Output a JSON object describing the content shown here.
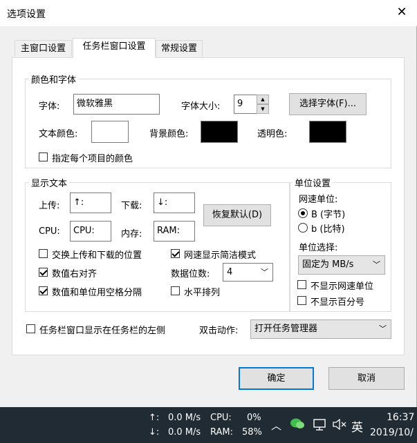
{
  "window": {
    "title": "选项设置",
    "close_glyph": "✕"
  },
  "tabs": [
    {
      "label": "主窗口设置"
    },
    {
      "label": "任务栏窗口设置"
    },
    {
      "label": "常规设置"
    }
  ],
  "color_font": {
    "group_label": "颜色和字体",
    "font_label": "字体:",
    "font_value": "微软雅黑",
    "size_label": "字体大小:",
    "size_value": "9",
    "choose_font_button": "选择字体(F)...",
    "text_color_label": "文本颜色:",
    "text_color": "#ffffff",
    "bg_color_label": "背景颜色:",
    "bg_color": "#000000",
    "transparent_label": "透明色:",
    "transparent_color": "#000000",
    "per_item_color_label": "指定每个项目的颜色",
    "per_item_color_checked": false
  },
  "display_text": {
    "group_label": "显示文本",
    "upload_label": "上传:",
    "upload_value": "↑:",
    "download_label": "下载:",
    "download_value": "↓:",
    "cpu_label": "CPU:",
    "cpu_value": "CPU:",
    "memory_label": "内存:",
    "memory_value": "RAM:",
    "restore_default_button": "恢复默认(D)",
    "swap_label": "交换上传和下载的位置",
    "swap_checked": false,
    "simple_mode_label": "网速显示简洁模式",
    "simple_mode_checked": true,
    "right_align_label": "数值右对齐",
    "right_align_checked": true,
    "digits_label": "数据位数:",
    "digits_value": "4",
    "space_sep_label": "数值和单位用空格分隔",
    "space_sep_checked": true,
    "horizontal_label": "水平排列",
    "horizontal_checked": false
  },
  "unit_settings": {
    "group_label": "单位设置",
    "speed_unit_label": "网速单位:",
    "byte_option": "B (字节)",
    "byte_selected": true,
    "bit_option": "b (比特)",
    "bit_selected": false,
    "unit_select_label": "单位选择:",
    "unit_select_value": "固定为 MB/s",
    "hide_speed_unit_label": "不显示网速单位",
    "hide_speed_unit_checked": false,
    "hide_percent_label": "不显示百分号",
    "hide_percent_checked": false
  },
  "bottom_options": {
    "left_of_taskbar_label": "任务栏窗口显示在任务栏的左侧",
    "left_of_taskbar_checked": false,
    "double_click_label": "双击动作:",
    "double_click_value": "打开任务管理器"
  },
  "buttons": {
    "ok": "确定",
    "cancel": "取消"
  },
  "taskbar": {
    "up_arrow": "↑:",
    "up_speed": "0.0 M/s",
    "cpu_label": "CPU:",
    "cpu_value": "0%",
    "down_arrow": "↓:",
    "down_speed": "0.0 M/s",
    "ram_label": "RAM:",
    "ram_value": "58%",
    "ime": "英",
    "time": "16:37",
    "date": "2019/10/"
  }
}
